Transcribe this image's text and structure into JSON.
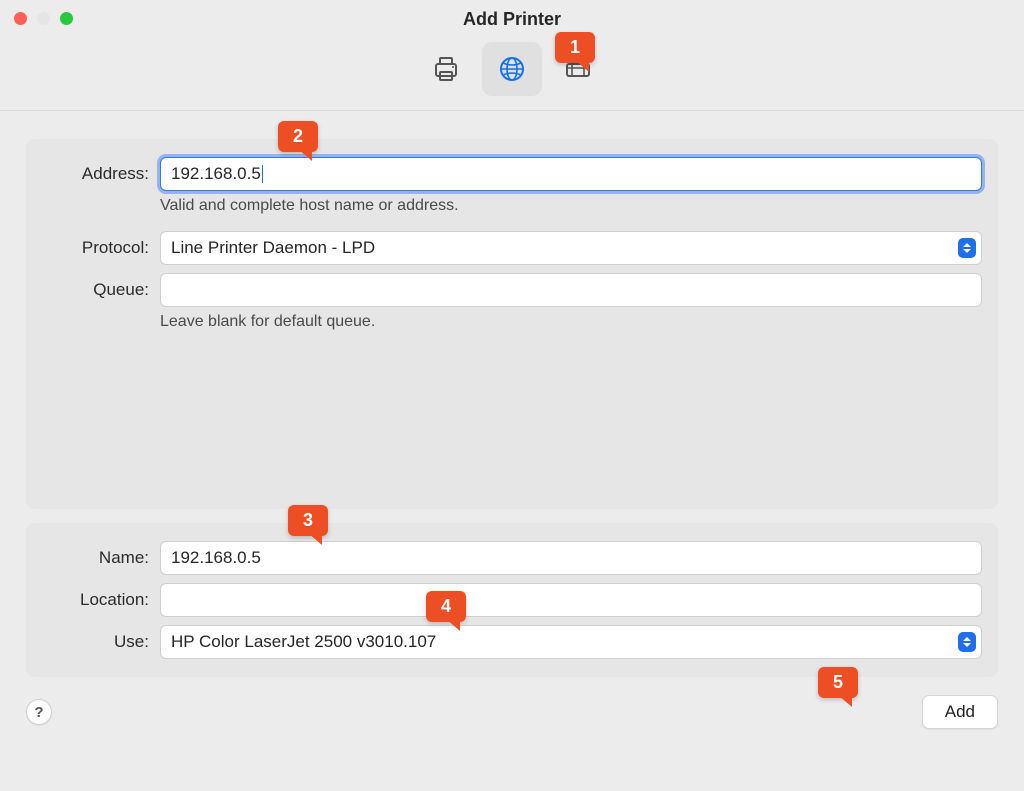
{
  "window": {
    "title": "Add Printer"
  },
  "tabs": {
    "default_label": "Default",
    "ip_label": "IP",
    "windows_label": "Windows"
  },
  "fields": {
    "address_label": "Address:",
    "address_value": "192.168.0.5",
    "address_help": "Valid and complete host name or address.",
    "protocol_label": "Protocol:",
    "protocol_value": "Line Printer Daemon - LPD",
    "queue_label": "Queue:",
    "queue_value": "",
    "queue_help": "Leave blank for default queue.",
    "name_label": "Name:",
    "name_value": "192.168.0.5",
    "location_label": "Location:",
    "location_value": "",
    "use_label": "Use:",
    "use_value": "HP Color LaserJet 2500 v3010.107"
  },
  "buttons": {
    "add_label": "Add",
    "help_label": "?"
  },
  "callouts": {
    "c1": "1",
    "c2": "2",
    "c3": "3",
    "c4": "4",
    "c5": "5"
  }
}
